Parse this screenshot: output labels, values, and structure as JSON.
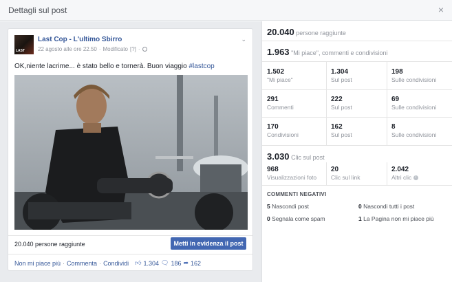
{
  "dialog": {
    "title": "Dettagli sul post",
    "close": "×"
  },
  "post": {
    "page_name": "Last Cop - L'ultimo Sbirro",
    "date": "22 agosto alle ore 22.50",
    "modified": "Modificato",
    "modified_help": "[?]",
    "text": "OK,niente lacrime... è stato bello e tornerà. Buon viaggio ",
    "hashtag": "#lastcop",
    "avatar_text": "LAST",
    "reach_text": "20.040 persone raggiunte",
    "boost_label": "Metti in evidenza il post",
    "actions": {
      "like": "Non mi piace più",
      "comment": "Commenta",
      "share": "Condividi",
      "likes_count": "1.304",
      "comments_count": "186",
      "shares_count": "162"
    }
  },
  "stats": {
    "reach": {
      "value": "20.040",
      "label": "persone raggiunte"
    },
    "engagement": {
      "value": "1.963",
      "label": "\"Mi piace\", commenti e condivisioni"
    },
    "grid": [
      {
        "value": "1.502",
        "label": "\"Mi piace\""
      },
      {
        "value": "1.304",
        "label": "Sul post"
      },
      {
        "value": "198",
        "label": "Sulle condivisioni"
      },
      {
        "value": "291",
        "label": "Commenti"
      },
      {
        "value": "222",
        "label": "Sul post"
      },
      {
        "value": "69",
        "label": "Sulle condivisioni"
      },
      {
        "value": "170",
        "label": "Condivisioni"
      },
      {
        "value": "162",
        "label": "Sul post"
      },
      {
        "value": "8",
        "label": "Sulle condivisioni"
      }
    ],
    "clicks": {
      "value": "3.030",
      "label": "Clic sul post"
    },
    "click_grid": [
      {
        "value": "968",
        "label": "Visualizzazioni foto"
      },
      {
        "value": "20",
        "label": "Clic sul link"
      },
      {
        "value": "2.042",
        "label": "Altri clic"
      }
    ],
    "negative": {
      "title": "COMMENTI NEGATIVI",
      "items": [
        {
          "value": "5",
          "label": "Nascondi post"
        },
        {
          "value": "0",
          "label": "Nascondi tutti i post"
        },
        {
          "value": "0",
          "label": "Segnala come spam"
        },
        {
          "value": "1",
          "label": "La Pagina non mi piace più"
        }
      ]
    }
  },
  "colors": {
    "link": "#365899",
    "button": "#4267b2",
    "muted": "#90949c",
    "panel_bg": "#e9ebee"
  },
  "icons": [
    "close-icon",
    "globe-icon",
    "chevron-down-icon",
    "thumbs-up-icon",
    "comment-icon",
    "share-icon",
    "info-icon"
  ]
}
